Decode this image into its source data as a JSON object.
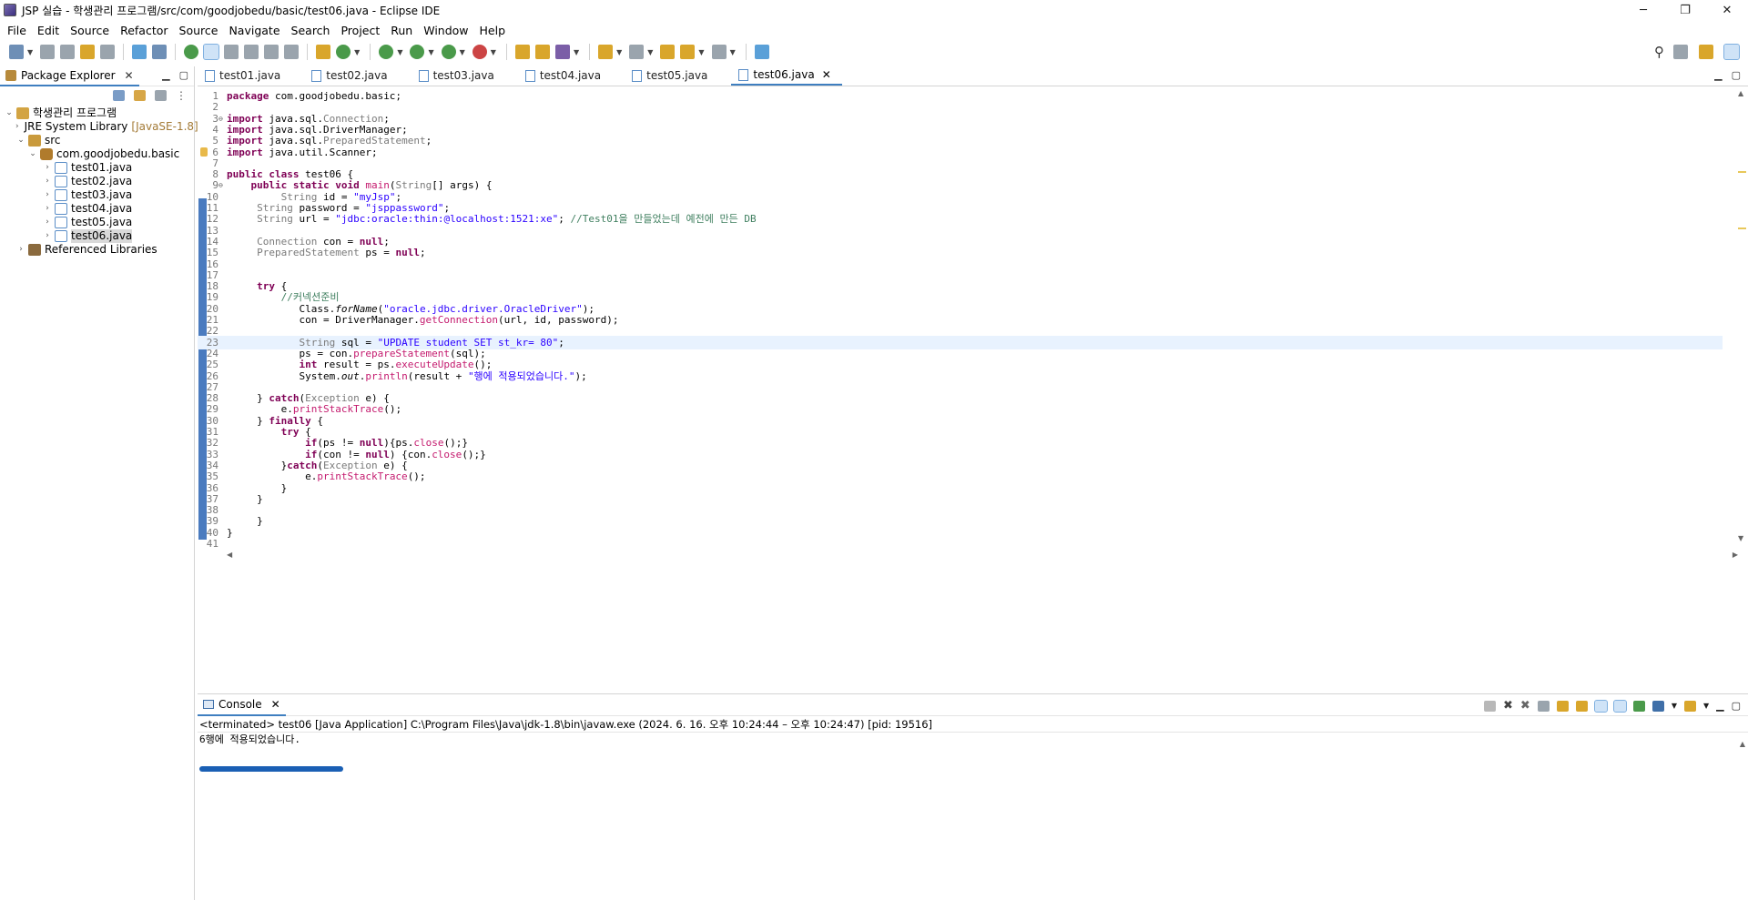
{
  "window": {
    "title": "JSP 실습 - 학생관리 프로그램/src/com/goodjobedu/basic/test06.java - Eclipse IDE",
    "minimize": "─",
    "maximize": "❐",
    "close": "✕"
  },
  "menu": [
    "File",
    "Edit",
    "Source",
    "Refactor",
    "Source",
    "Navigate",
    "Search",
    "Project",
    "Run",
    "Window",
    "Help"
  ],
  "package_explorer": {
    "tab_label": "Package Explorer",
    "tree": {
      "project": "학생관리 프로그램",
      "jre": "JRE System Library",
      "jre_version": "[JavaSE-1.8]",
      "src": "src",
      "package": "com.goodjobedu.basic",
      "files": [
        "test01.java",
        "test02.java",
        "test03.java",
        "test04.java",
        "test05.java",
        "test06.java"
      ],
      "selected_file": "test06.java",
      "referenced": "Referenced Libraries"
    }
  },
  "editor": {
    "tabs": [
      "test01.java",
      "test02.java",
      "test03.java",
      "test04.java",
      "test05.java",
      "test06.java"
    ],
    "active_tab": "test06.java",
    "current_line": 23,
    "lines": [
      {
        "n": "1",
        "t": "package com.goodjobedu.basic;"
      },
      {
        "n": "2",
        "t": ""
      },
      {
        "n": "3",
        "t": "import java.sql.Connection;"
      },
      {
        "n": "4",
        "t": "import java.sql.DriverManager;"
      },
      {
        "n": "5",
        "t": "import java.sql.PreparedStatement;"
      },
      {
        "n": "6",
        "t": "import java.util.Scanner;"
      },
      {
        "n": "7",
        "t": ""
      },
      {
        "n": "8",
        "t": "public class test06 {"
      },
      {
        "n": "9",
        "t": "    public static void main(String[] args) {"
      },
      {
        "n": "10",
        "t": "         String id = \"myJsp\";"
      },
      {
        "n": "11",
        "t": "     String password = \"jsppassword\";"
      },
      {
        "n": "12",
        "t": "     String url = \"jdbc:oracle:thin:@localhost:1521:xe\"; //Test01을 만들었는데 예전에 만든 DB"
      },
      {
        "n": "13",
        "t": ""
      },
      {
        "n": "14",
        "t": "     Connection con = null;"
      },
      {
        "n": "15",
        "t": "     PreparedStatement ps = null;"
      },
      {
        "n": "16",
        "t": ""
      },
      {
        "n": "17",
        "t": ""
      },
      {
        "n": "18",
        "t": "     try {"
      },
      {
        "n": "19",
        "t": "         //커넥션준비"
      },
      {
        "n": "20",
        "t": "            Class.forName(\"oracle.jdbc.driver.OracleDriver\");"
      },
      {
        "n": "21",
        "t": "            con = DriverManager.getConnection(url, id, password);"
      },
      {
        "n": "22",
        "t": ""
      },
      {
        "n": "23",
        "t": "            String sql = \"UPDATE student SET st_kr= 80\";"
      },
      {
        "n": "24",
        "t": "            ps = con.prepareStatement(sql);"
      },
      {
        "n": "25",
        "t": "            int result = ps.executeUpdate();"
      },
      {
        "n": "26",
        "t": "            System.out.println(result + \"행에 적용되었습니다.\");"
      },
      {
        "n": "27",
        "t": ""
      },
      {
        "n": "28",
        "t": "     } catch(Exception e) {"
      },
      {
        "n": "29",
        "t": "         e.printStackTrace();"
      },
      {
        "n": "30",
        "t": "     } finally {"
      },
      {
        "n": "31",
        "t": "         try {"
      },
      {
        "n": "32",
        "t": "             if(ps != null){ps.close();}"
      },
      {
        "n": "33",
        "t": "             if(con != null) {con.close();}"
      },
      {
        "n": "34",
        "t": "         }catch(Exception e) {"
      },
      {
        "n": "35",
        "t": "             e.printStackTrace();"
      },
      {
        "n": "36",
        "t": "         }"
      },
      {
        "n": "37",
        "t": "     }"
      },
      {
        "n": "38",
        "t": ""
      },
      {
        "n": "39",
        "t": "     }"
      },
      {
        "n": "40",
        "t": "}"
      },
      {
        "n": "41",
        "t": ""
      }
    ]
  },
  "console": {
    "tab_label": "Console",
    "status": "<terminated> test06 [Java Application] C:\\Program Files\\Java\\jdk-1.8\\bin\\javaw.exe  (2024. 6. 16. 오후 10:24:44 – 오후 10:24:47) [pid: 19516]",
    "output": "6행에 적용되었습니다."
  },
  "colors": {
    "keyword": "#7f0055",
    "string": "#2a00ff",
    "comment": "#3f7f5f",
    "selection_tab": "#3f7fc0",
    "annotation_stroke": "#1a5fb4"
  }
}
